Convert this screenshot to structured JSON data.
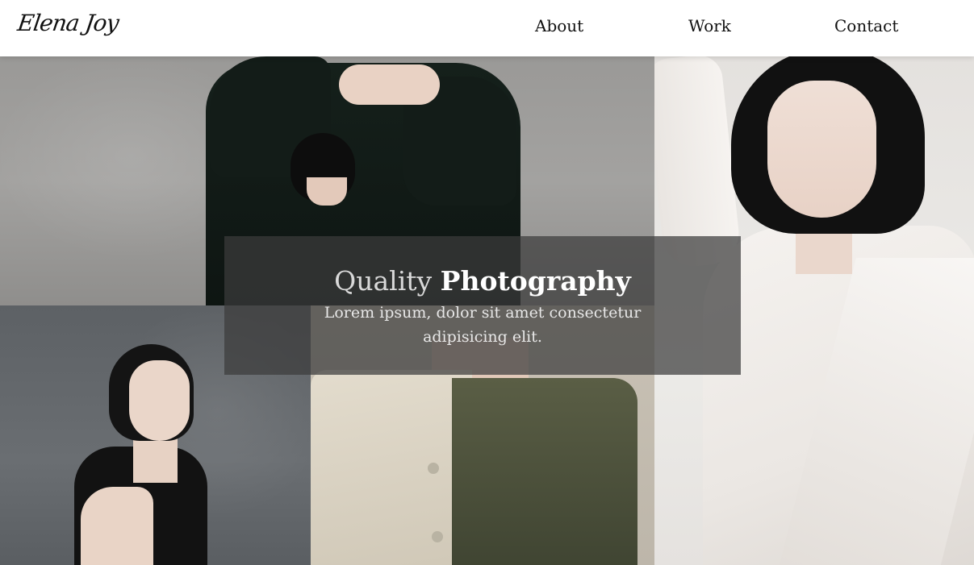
{
  "header": {
    "logo": "Elena Joy",
    "nav": [
      {
        "label": "About"
      },
      {
        "label": "Work"
      },
      {
        "label": "Contact"
      }
    ]
  },
  "hero": {
    "title_light": "Quality",
    "title_bold": "Photography",
    "subtitle": "Lorem ipsum, dolor sit amet consectetur adipisicing elit."
  },
  "gallery": {
    "photos": [
      {
        "description": "model-arms-overhead-dark-coat"
      },
      {
        "description": "model-white-outfit"
      },
      {
        "description": "model-black-top-hand-on-neck"
      },
      {
        "description": "model-olive-felt-coat"
      }
    ]
  },
  "colors": {
    "header_bg": "#ffffff",
    "overlay_bg": "#3c3c3c",
    "text_dark": "#111111",
    "text_light": "#f2f2f2"
  }
}
